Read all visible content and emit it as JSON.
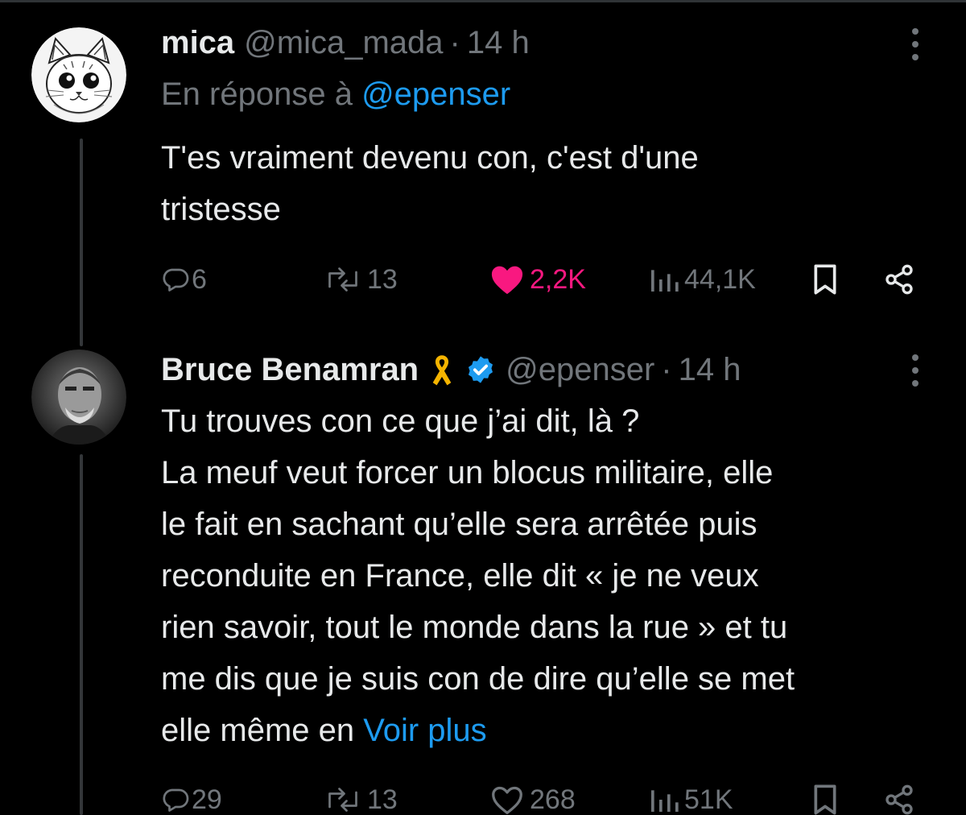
{
  "colors": {
    "background": "#000000",
    "text": "#e7e9ea",
    "muted": "#71767b",
    "link": "#1d9bf0",
    "like": "#f91880",
    "verified": "#1d9bf0",
    "ribbon": "#f5b400"
  },
  "tweets": [
    {
      "name": "mica",
      "handle": "@mica_mada",
      "separator": "·",
      "time": "14 h",
      "reply_prefix": "En réponse à",
      "reply_handle": "@epenser",
      "text_lines": [
        "T'es vraiment devenu con, c'est d'une",
        "tristesse"
      ],
      "avatar_icon": "cat-drawing-avatar",
      "actions": {
        "replies": "6",
        "retweets": "13",
        "likes": "2,2K",
        "liked": true,
        "views": "44,1K"
      }
    },
    {
      "name": "Bruce Benamran",
      "handle": "@epenser",
      "separator": "·",
      "time": "14 h",
      "badges": [
        "yellow-ribbon-icon",
        "verified-badge-icon"
      ],
      "avatar_icon": "bw-portrait-avatar",
      "text_lines": [
        "Tu trouves con ce que j’ai dit, là ?",
        "La meuf veut forcer un blocus militaire, elle",
        "le fait en sachant qu’elle sera arrêtée puis",
        "reconduite en France, elle dit « je ne veux",
        "rien savoir, tout le monde dans la rue » et tu",
        "me dis que je suis con de dire qu’elle se met",
        "elle même en"
      ],
      "see_more": "Voir plus",
      "actions": {
        "replies": "29",
        "retweets": "13",
        "likes": "268",
        "liked": false,
        "views": "51K"
      }
    }
  ]
}
